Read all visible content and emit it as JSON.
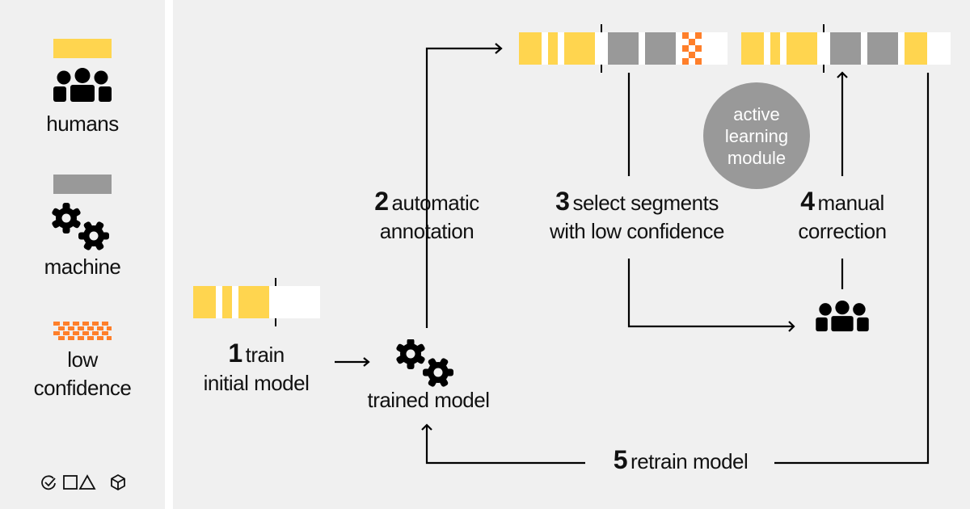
{
  "colors": {
    "human": "#ffd54f",
    "machine": "#999999",
    "low_confidence": "#ff7f2a",
    "empty": "#ffffff",
    "background": "#f0f0f0",
    "line": "#000000"
  },
  "legend": {
    "items": [
      {
        "key": "human",
        "label": "humans",
        "icon": "people-icon"
      },
      {
        "key": "machine",
        "label": "machine",
        "icon": "gears-icon"
      },
      {
        "key": "low_confidence",
        "label_line1": "low",
        "label_line2": "confidence",
        "icon": "checker-swatch"
      }
    ],
    "footer_icons": [
      "check-circle-icon",
      "square-icon",
      "triangle-icon",
      "cube-icon"
    ]
  },
  "steps": {
    "s1": {
      "num": "1",
      "line1": "train",
      "line2": "initial model"
    },
    "model_label": "trained model",
    "s2": {
      "num": "2",
      "line1": "automatic",
      "line2": "annotation"
    },
    "s3": {
      "num": "3",
      "line1": "select segments",
      "line2": "with low confidence"
    },
    "s4": {
      "num": "4",
      "line1": "manual",
      "line2": "correction"
    },
    "s5": {
      "num": "5",
      "line1": "retrain model"
    }
  },
  "module": {
    "line1": "active",
    "line2": "learning",
    "line3": "module"
  },
  "bars": {
    "initial": [
      "human",
      "gap",
      "human",
      "gap",
      "human",
      "marker",
      "empty"
    ],
    "annotated": [
      "human",
      "gap",
      "human",
      "gap",
      "human",
      "marker",
      "machine",
      "gap",
      "machine",
      "gap",
      "low_confidence",
      "empty"
    ],
    "corrected": [
      "human",
      "gap",
      "human",
      "gap",
      "human",
      "marker",
      "machine",
      "gap",
      "machine",
      "gap",
      "human",
      "empty"
    ]
  }
}
